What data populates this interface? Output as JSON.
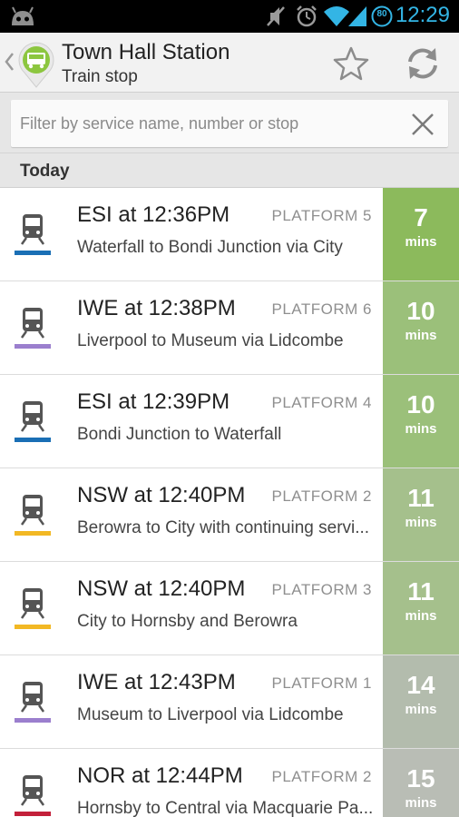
{
  "status_bar": {
    "time": "12:29",
    "battery": "80",
    "icons": [
      "android-icon",
      "mute-icon",
      "alarm-icon",
      "wifi-icon",
      "signal-icon",
      "battery-icon"
    ],
    "accent": "#33b5e5"
  },
  "header": {
    "title": "Town Hall Station",
    "subtitle": "Train stop",
    "icons": [
      "back-chevron-icon",
      "train-stop-icon",
      "star-icon",
      "refresh-icon"
    ]
  },
  "filter": {
    "placeholder": "Filter by service name, number or stop",
    "value": ""
  },
  "section_title": "Today",
  "departures": [
    {
      "service": "ESI at 12:36PM",
      "platform": "PLATFORM 5",
      "route": "Waterfall to Bondi Junction via City",
      "eta": "7",
      "unit": "mins",
      "line_color": "#1a6fb5",
      "eta_color": "#8cba5c"
    },
    {
      "service": "IWE at 12:38PM",
      "platform": "PLATFORM 6",
      "route": "Liverpool to Museum via Lidcombe",
      "eta": "10",
      "unit": "mins",
      "line_color": "#9b7fce",
      "eta_color": "#9bc07a"
    },
    {
      "service": "ESI at 12:39PM",
      "platform": "PLATFORM 4",
      "route": "Bondi Junction to Waterfall",
      "eta": "10",
      "unit": "mins",
      "line_color": "#1a6fb5",
      "eta_color": "#9bc07a"
    },
    {
      "service": "NSW at 12:40PM",
      "platform": "PLATFORM 2",
      "route": "Berowra to City with continuing servi...",
      "eta": "11",
      "unit": "mins",
      "line_color": "#f2b824",
      "eta_color": "#a5c08c"
    },
    {
      "service": "NSW at 12:40PM",
      "platform": "PLATFORM 3",
      "route": "City to Hornsby and Berowra",
      "eta": "11",
      "unit": "mins",
      "line_color": "#f2b824",
      "eta_color": "#a5c08c"
    },
    {
      "service": "IWE at 12:43PM",
      "platform": "PLATFORM 1",
      "route": "Museum to Liverpool via Lidcombe",
      "eta": "14",
      "unit": "mins",
      "line_color": "#9b7fce",
      "eta_color": "#b3bcad"
    },
    {
      "service": "NOR at 12:44PM",
      "platform": "PLATFORM 2",
      "route": "Hornsby to Central via Macquarie Pa...",
      "eta": "15",
      "unit": "mins",
      "line_color": "#c3203a",
      "eta_color": "#b9bdb5"
    }
  ]
}
